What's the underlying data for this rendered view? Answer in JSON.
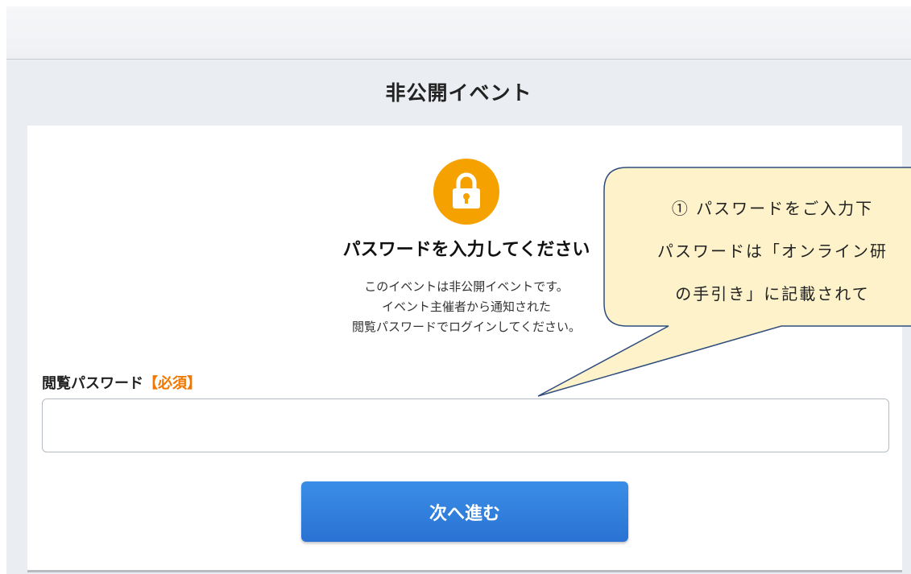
{
  "page": {
    "title": "非公開イベント"
  },
  "card": {
    "lock_icon": "lock-icon",
    "heading": "パスワードを入力してください",
    "description": [
      "このイベントは非公開イベントです。",
      "イベント主催者から通知された",
      "閲覧パスワードでログインしてください。"
    ]
  },
  "form": {
    "label": "閲覧パスワード",
    "required": "【必須】",
    "password_value": "",
    "placeholder": "",
    "submit_label": "次へ進む"
  },
  "callout": {
    "lines": [
      "① パスワードをご入力下",
      "パスワードは「オンライン研",
      "の手引き」に記載されて"
    ]
  },
  "colors": {
    "lock_orange": "#f5a200",
    "button_blue": "#2a72d4",
    "required_orange": "#f07800",
    "callout_fill": "#fdf2c9",
    "callout_border": "#2f4d7e"
  }
}
